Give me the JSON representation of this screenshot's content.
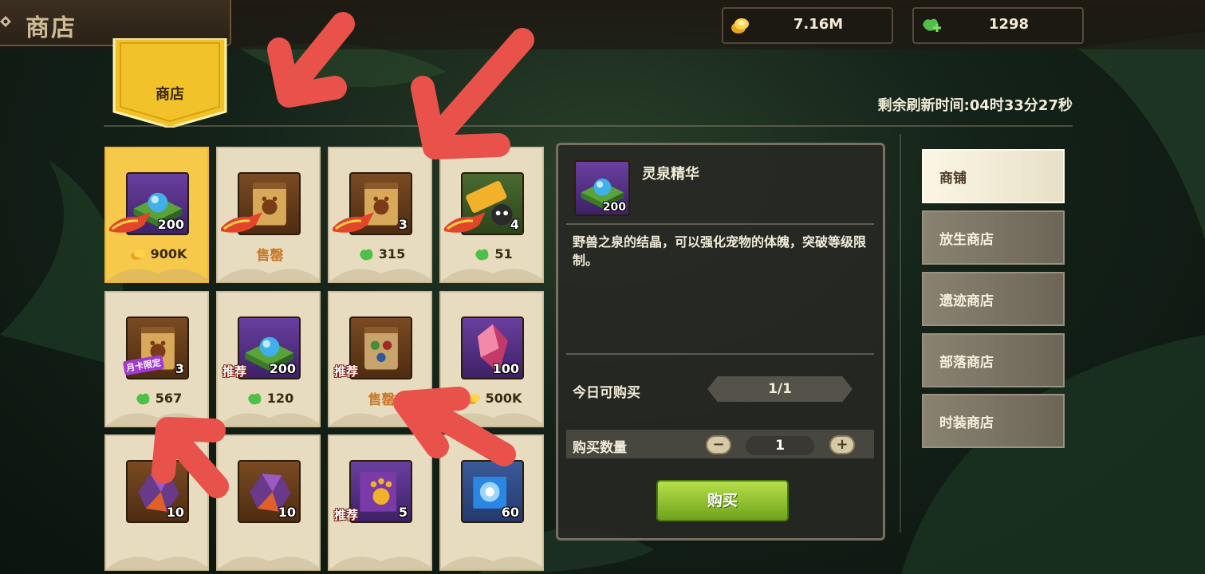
{
  "header": {
    "title": "商店",
    "currencies": [
      {
        "icon": "gold-coin-icon",
        "value": "7.16M"
      },
      {
        "icon": "green-gem-add-icon",
        "value": "1298"
      }
    ]
  },
  "banner": {
    "label": "商店"
  },
  "refresh_text": "剩余刷新时间:04时33分27秒",
  "grid": {
    "items": [
      {
        "icon": "spring-essence-icon",
        "frame": "purple",
        "qty": "200",
        "tag": "must-buy",
        "price_icon": "gold-coin-icon",
        "price": "900K",
        "selected": true
      },
      {
        "icon": "beast-scroll-icon",
        "frame": "brown",
        "qty": "",
        "tag": "must-buy",
        "sold_out": "售罄"
      },
      {
        "icon": "beast-scroll-icon",
        "frame": "brown",
        "qty": "3",
        "tag": "must-buy",
        "price_icon": "green-gem-icon",
        "price": "315"
      },
      {
        "icon": "ticket-skull-icon",
        "frame": "green",
        "qty": "4",
        "tag": "must-buy",
        "price_icon": "green-gem-icon",
        "price": "51"
      },
      {
        "icon": "beast-scroll-icon",
        "frame": "brown",
        "qty": "3",
        "tag": "month-card",
        "tag_text": "月卡限定",
        "price_icon": "green-gem-icon",
        "price": "567"
      },
      {
        "icon": "spring-essence-icon",
        "frame": "purple",
        "qty": "200",
        "tag": "recommend",
        "tag_text": "推荐",
        "price_icon": "green-gem-icon",
        "price": "120"
      },
      {
        "icon": "rune-scroll-icon",
        "frame": "brown",
        "qty": "",
        "tag": "recommend",
        "tag_text": "推荐",
        "sold_out": "售罄"
      },
      {
        "icon": "crystal-shard-icon",
        "frame": "purple",
        "qty": "100",
        "tag": "",
        "price_icon": "gold-coin-icon",
        "price": "500K"
      },
      {
        "icon": "ore-stone-icon",
        "frame": "brown",
        "qty": "10",
        "tag": ""
      },
      {
        "icon": "ore-stone-icon",
        "frame": "brown",
        "qty": "10",
        "tag": ""
      },
      {
        "icon": "paw-puzzle-icon",
        "frame": "purple",
        "qty": "5",
        "tag": "recommend",
        "tag_text": "推荐"
      },
      {
        "icon": "blue-puzzle-icon",
        "frame": "blue",
        "qty": "60",
        "tag": ""
      }
    ]
  },
  "detail": {
    "name": "灵泉精华",
    "qty": "200",
    "description": "野兽之泉的结晶，可以强化宠物的体魄，突破等级限制。",
    "limit_label": "今日可购买",
    "limit_value": "1/1",
    "quantity_label": "购买数量",
    "quantity_value": "1",
    "minus": "−",
    "plus": "+",
    "buy_label": "购买"
  },
  "side_tabs": [
    {
      "label": "商铺",
      "active": true
    },
    {
      "label": "放生商店"
    },
    {
      "label": "遗迹商店"
    },
    {
      "label": "部落商店"
    },
    {
      "label": "时装商店"
    }
  ],
  "colors": {
    "gold": "#f6c94a",
    "buy_green": "#8cc22a",
    "annotation_red": "#e8524a",
    "card_bg": "#e7dcc0"
  }
}
